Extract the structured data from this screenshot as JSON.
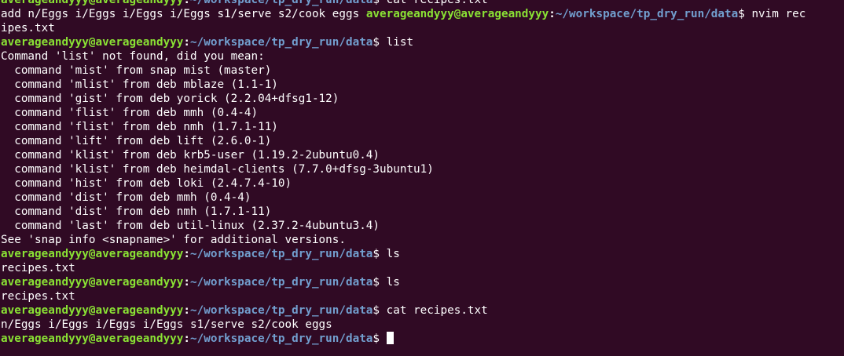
{
  "colors": {
    "background": "#300a24",
    "text": "#ffffff",
    "prompt_user": "#8ae234",
    "prompt_path": "#729fcf"
  },
  "prompt": {
    "user_host": "averageandyyy@averageandyyy",
    "separator": ":",
    "path": "~/workspace/tp_dry_run/data",
    "symbol": "$"
  },
  "lines": [
    {
      "type": "prompt",
      "command": " cat recipes.txt"
    },
    {
      "type": "mixed",
      "prefix": "add n/Eggs i/Eggs i/Eggs i/Eggs s1/serve s2/cook eggs ",
      "command": " nvim rec"
    },
    {
      "type": "output",
      "text": "ipes.txt"
    },
    {
      "type": "prompt",
      "command": " list"
    },
    {
      "type": "output",
      "text": "Command 'list' not found, did you mean:"
    },
    {
      "type": "output",
      "text": "  command 'mist' from snap mist (master)"
    },
    {
      "type": "output",
      "text": "  command 'mlist' from deb mblaze (1.1-1)"
    },
    {
      "type": "output",
      "text": "  command 'gist' from deb yorick (2.2.04+dfsg1-12)"
    },
    {
      "type": "output",
      "text": "  command 'flist' from deb mmh (0.4-4)"
    },
    {
      "type": "output",
      "text": "  command 'flist' from deb nmh (1.7.1-11)"
    },
    {
      "type": "output",
      "text": "  command 'lift' from deb lift (2.6.0-1)"
    },
    {
      "type": "output",
      "text": "  command 'klist' from deb krb5-user (1.19.2-2ubuntu0.4)"
    },
    {
      "type": "output",
      "text": "  command 'klist' from deb heimdal-clients (7.7.0+dfsg-3ubuntu1)"
    },
    {
      "type": "output",
      "text": "  command 'hist' from deb loki (2.4.7.4-10)"
    },
    {
      "type": "output",
      "text": "  command 'dist' from deb mmh (0.4-4)"
    },
    {
      "type": "output",
      "text": "  command 'dist' from deb nmh (1.7.1-11)"
    },
    {
      "type": "output",
      "text": "  command 'last' from deb util-linux (2.37.2-4ubuntu3.4)"
    },
    {
      "type": "output",
      "text": "See 'snap info <snapname>' for additional versions."
    },
    {
      "type": "prompt",
      "command": " ls"
    },
    {
      "type": "output",
      "text": "recipes.txt"
    },
    {
      "type": "prompt",
      "command": " ls"
    },
    {
      "type": "output",
      "text": "recipes.txt"
    },
    {
      "type": "prompt",
      "command": " cat recipes.txt"
    },
    {
      "type": "output",
      "text": "n/Eggs i/Eggs i/Eggs i/Eggs s1/serve s2/cook eggs"
    },
    {
      "type": "prompt",
      "command": " ",
      "cursor": true
    }
  ]
}
